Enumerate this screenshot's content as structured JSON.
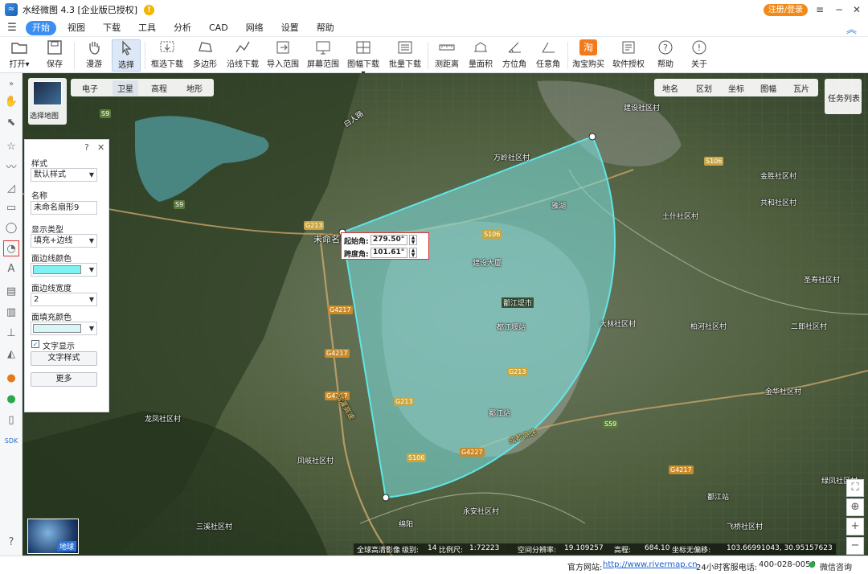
{
  "app": {
    "title": "水经微图 4.3 [企业版已授权]",
    "login_label": "注册/登录"
  },
  "menu": {
    "items": [
      "开始",
      "视图",
      "下载",
      "工具",
      "分析",
      "CAD",
      "网络",
      "设置",
      "帮助"
    ],
    "active": "开始"
  },
  "toolbar": {
    "open": "打开",
    "save": "保存",
    "pan": "漫游",
    "select": "选择",
    "box_download": "框选下载",
    "polygon": "多边形",
    "line_download": "沿线下载",
    "import_range": "导入范围",
    "screen_range": "屏幕范围",
    "sheet_download": "图幅下载",
    "batch_download": "批量下载",
    "measure_distance": "测距离",
    "measure_area": "量面积",
    "azimuth": "方位角",
    "any_angle": "任意角",
    "taobao_icon_char": "淘",
    "taobao": "淘宝购买",
    "license": "软件授权",
    "help": "帮助",
    "about": "关于"
  },
  "map": {
    "select_map_label": "选择地图",
    "basemap_tabs": [
      "电子",
      "卫星",
      "高程",
      "地形"
    ],
    "active_basemap": "卫星",
    "right_tabs": [
      "地名",
      "区划",
      "坐标",
      "图幅",
      "瓦片"
    ],
    "task_list": "任务列表",
    "globe_label": "地球",
    "places": [
      {
        "name": "建设社区村"
      },
      {
        "name": "万岭社区村"
      },
      {
        "name": "金胜社区村"
      },
      {
        "name": "共和社区村"
      },
      {
        "name": "土什社区村"
      },
      {
        "name": "建设大厦"
      },
      {
        "name": "鄱江堤市"
      },
      {
        "name": "大林社区村"
      },
      {
        "name": "柏河社区村"
      },
      {
        "name": "二郎社区村"
      },
      {
        "name": "圣寿社区村"
      },
      {
        "name": "龙凤社区村"
      },
      {
        "name": "凤岐社区村"
      },
      {
        "name": "金华社区村"
      },
      {
        "name": "永安社区村"
      },
      {
        "name": "三溪社区村"
      },
      {
        "name": "飞桥社区村"
      },
      {
        "name": "绿凤社区村"
      },
      {
        "name": "未命名扇形9"
      },
      {
        "name": "白人路"
      },
      {
        "name": "都江堰站"
      },
      {
        "name": "鄱江站"
      },
      {
        "name": "鄱江站"
      },
      {
        "name": "雅湖"
      },
      {
        "name": "绵阳"
      }
    ],
    "highways": [
      "S9",
      "S9",
      "G213",
      "S106",
      "G4217",
      "G4217",
      "G213",
      "G213",
      "S106",
      "G4227",
      "G4217",
      "G4217",
      "S59",
      "S106"
    ],
    "highway_names": [
      "成灌高速",
      "成都高速"
    ],
    "sector_editor": {
      "start_angle_label": "起始角:",
      "start_angle_value": "279.50°",
      "span_angle_label": "跨度角:",
      "span_angle_value": "101.61°"
    }
  },
  "panel": {
    "style_label": "样式",
    "style_value": "默认样式",
    "name_label": "名称",
    "name_value": "未命名扇形9",
    "display_type_label": "显示类型",
    "display_type_value": "填充+边线",
    "edge_color_label": "面边线颜色",
    "edge_color": "#7ef2f2",
    "edge_width_label": "面边线宽度",
    "edge_width_value": "2",
    "fill_color_label": "面填充颜色",
    "fill_color": "#d8f6f6",
    "text_display_label": "文字显示",
    "text_display_checked": true,
    "text_style_button": "文字样式",
    "more_button": "更多"
  },
  "status": {
    "imagery": "全球高清影像",
    "level_label": "级别:",
    "level": "14",
    "scale_label": "比例尺:",
    "scale": "1:72223",
    "resolution_label": "空间分辨率:",
    "resolution": "19.109257",
    "elevation_label": "高程:",
    "elevation": "684.10",
    "coord_label": "坐标无偏移:",
    "coord": "103.66991043, 30.95157623"
  },
  "footer": {
    "website_label": "官方网站:",
    "website": "http://www.rivermap.cn",
    "phone_label": "24小时客服电话:",
    "phone": "400-028-0050",
    "wechat": "微信咨询"
  },
  "colors": {
    "accent": "#3c8ef3",
    "sector_stroke": "#5fe6e6",
    "sector_fill": "#7be0e0",
    "login": "#f28a1a"
  }
}
